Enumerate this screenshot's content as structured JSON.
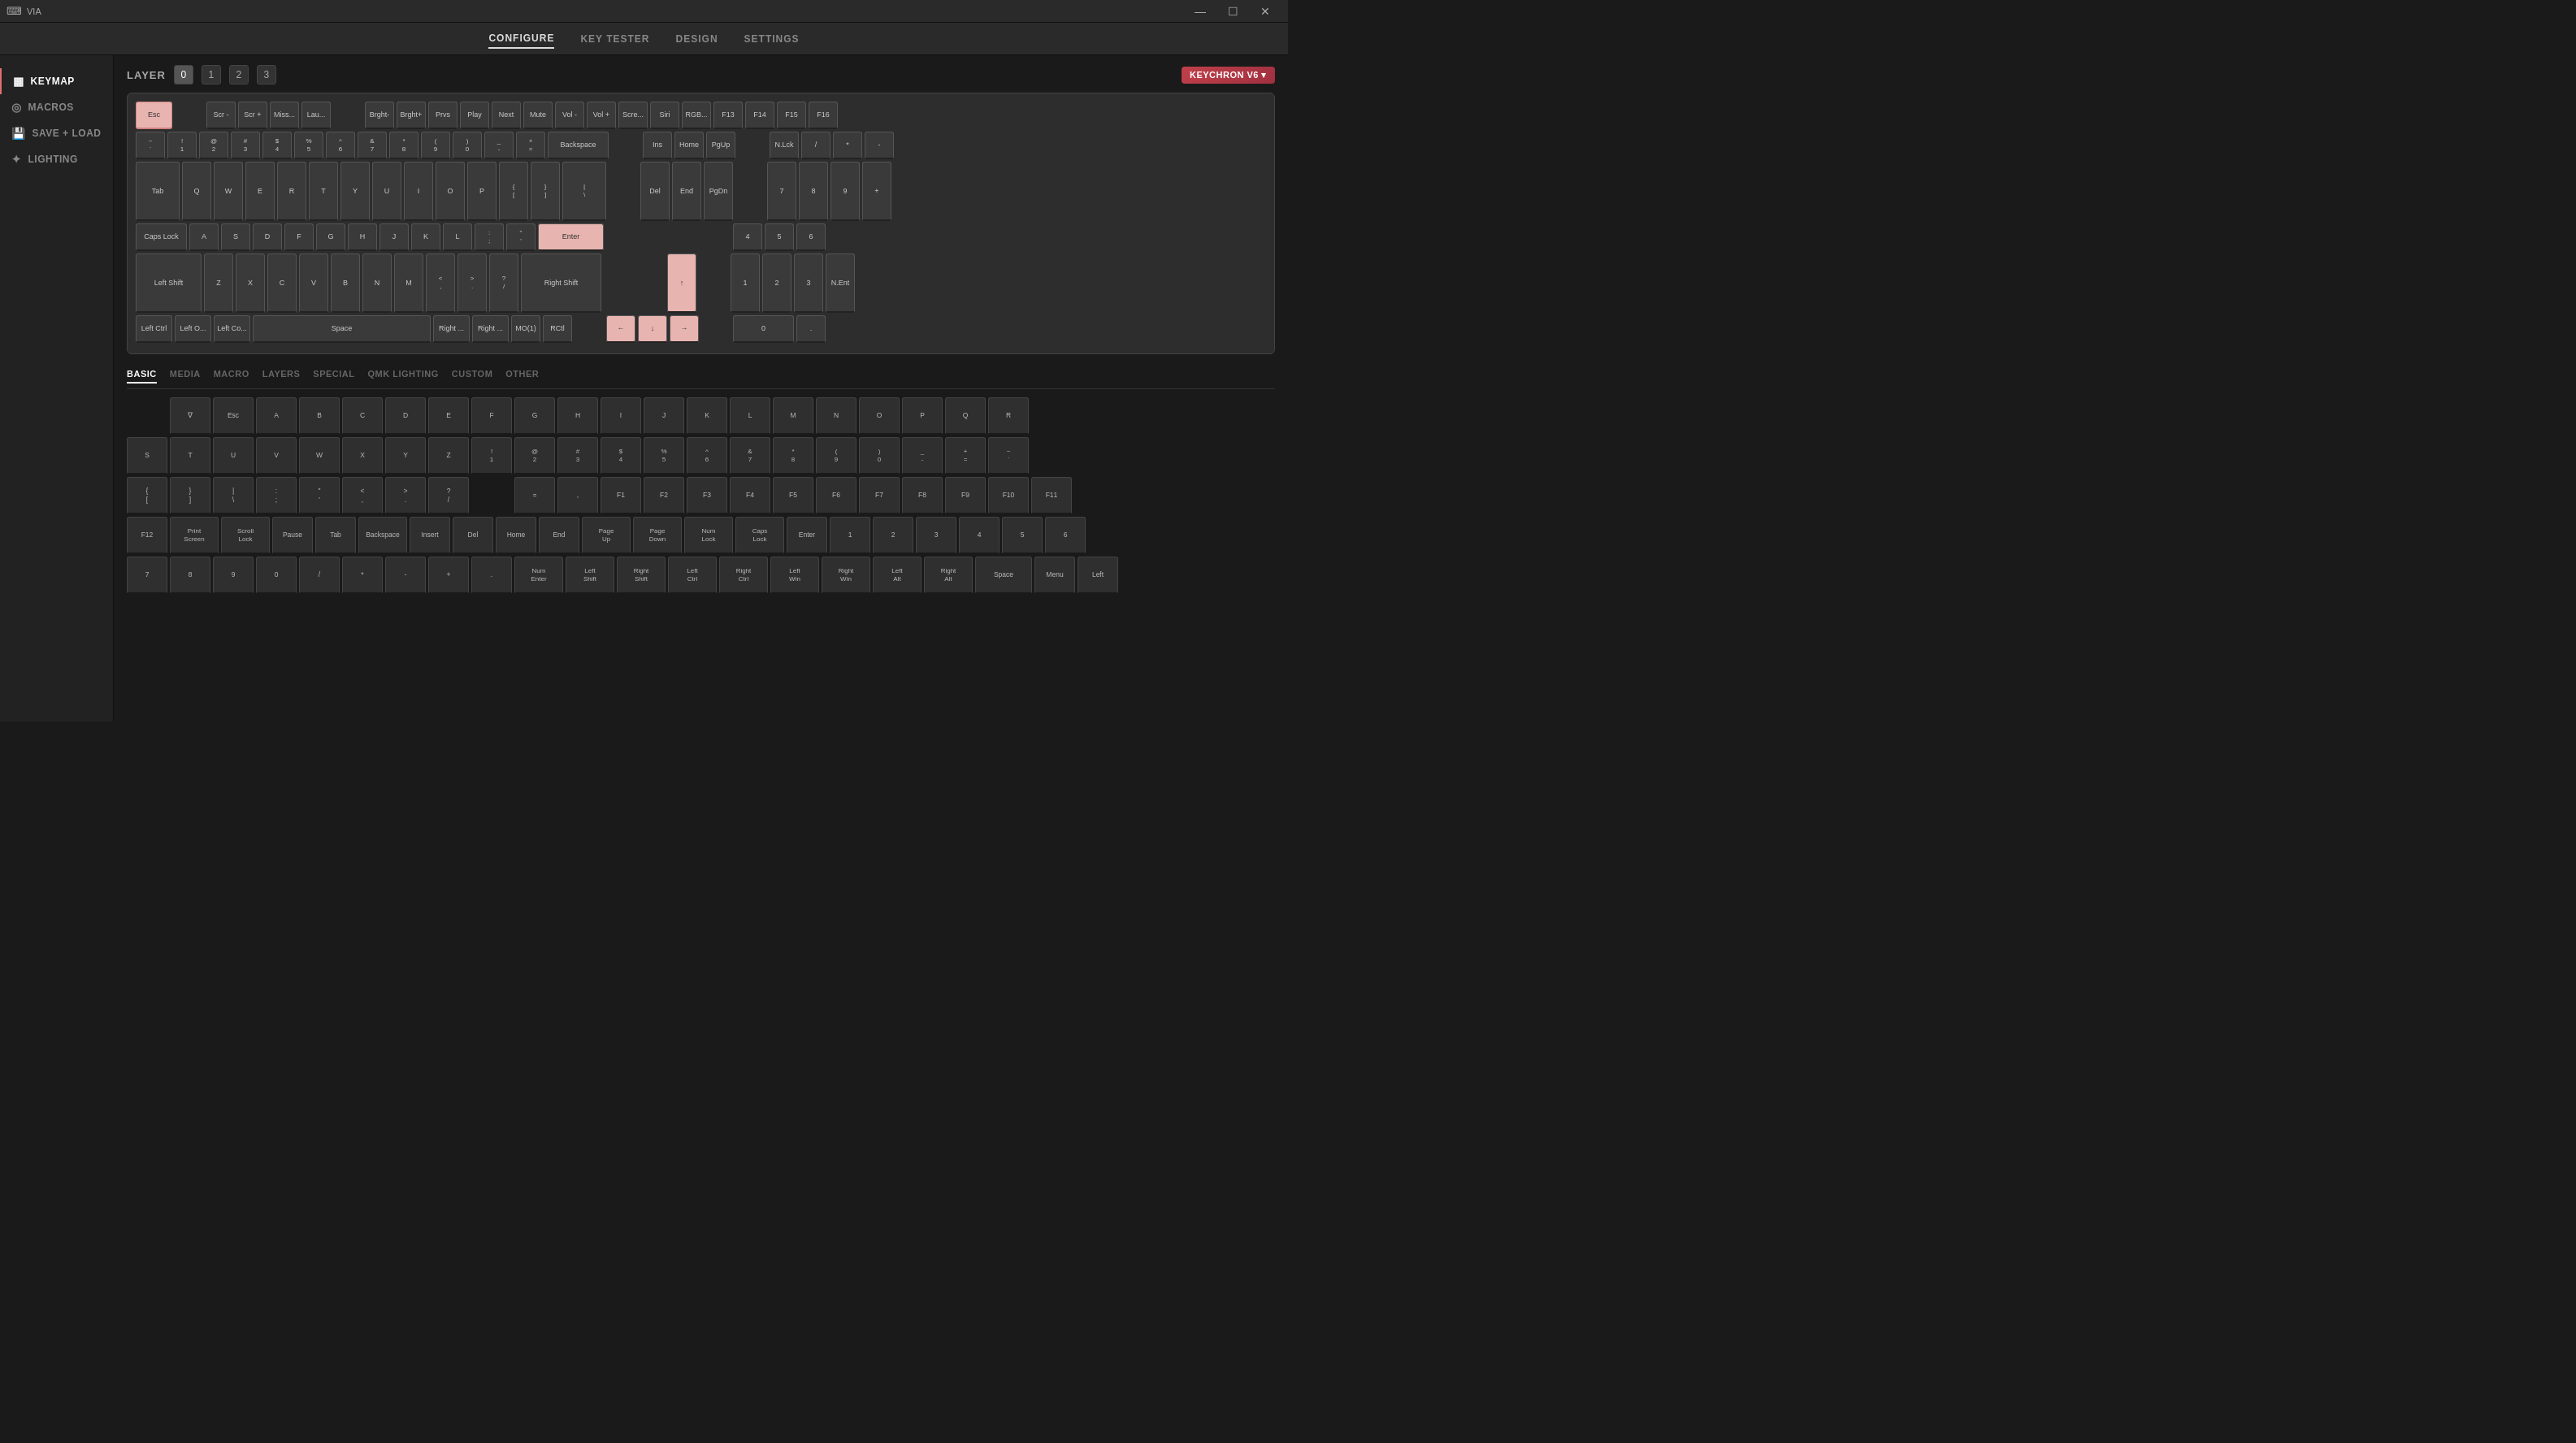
{
  "titlebar": {
    "app_name": "VIA",
    "controls": [
      "minimize",
      "maximize",
      "close"
    ]
  },
  "navbar": {
    "items": [
      {
        "label": "CONFIGURE",
        "active": true
      },
      {
        "label": "KEY TESTER",
        "active": false
      },
      {
        "label": "DESIGN",
        "active": false
      },
      {
        "label": "SETTINGS",
        "active": false
      }
    ]
  },
  "sidebar": {
    "items": [
      {
        "label": "KEYMAP",
        "icon": "grid",
        "active": true
      },
      {
        "label": "MACROS",
        "icon": "circle",
        "active": false
      },
      {
        "label": "SAVE + LOAD",
        "icon": "save",
        "active": false
      },
      {
        "label": "LIGHTING",
        "icon": "light",
        "active": false
      }
    ]
  },
  "layer": {
    "label": "LAYER",
    "values": [
      "0",
      "1",
      "2",
      "3"
    ],
    "active": "0"
  },
  "keychron_badge": "KEYCHRON V6 ▾",
  "keyboard": {
    "rows": [
      [
        "Esc",
        "",
        "Scr -",
        "Scr +",
        "Miss...",
        "Lau...",
        "",
        "Brght-",
        "Brght+",
        "Prvs",
        "Play",
        "Next",
        "Mute",
        "Vol -",
        "Vol +",
        "Scre...",
        "Siri",
        "RGB...",
        "F13",
        "F14",
        "F15",
        "F16"
      ],
      [
        "~`",
        "!1",
        "@2",
        "#3",
        "$4",
        "%5",
        "^6",
        "&7",
        "*8",
        "(9",
        ")0",
        "_-",
        "+=",
        "Backspace",
        "",
        "Ins",
        "Home",
        "PgUp",
        "",
        "N.Lck",
        "/",
        "*",
        "-"
      ],
      [
        "Tab",
        "",
        "Q",
        "W",
        "E",
        "R",
        "T",
        "Y",
        "U",
        "I",
        "O",
        "P",
        "{[",
        "}]",
        "|\\",
        "",
        "Del",
        "End",
        "PgDn",
        "",
        "7",
        "8",
        "9",
        "+"
      ],
      [
        "Caps Lock",
        "",
        "A",
        "S",
        "D",
        "F",
        "G",
        "H",
        "J",
        "K",
        "L",
        ":;",
        "'\"",
        "",
        "Enter",
        "",
        "",
        "",
        "",
        "",
        "4",
        "5",
        "6"
      ],
      [
        "Left Shift",
        "",
        "Z",
        "X",
        "C",
        "V",
        "B",
        "N",
        "M",
        "<,",
        ">.",
        "?/",
        "",
        "Right Shift",
        "",
        "",
        "",
        "↑",
        "",
        "",
        "1",
        "2",
        "3",
        "N.Ent"
      ],
      [
        "Left Ctrl",
        "Left O...",
        "Left Co...",
        "Space",
        "",
        "",
        "",
        "",
        "",
        "",
        "Right ...",
        "Right ...",
        "MO(1)",
        "RCtl",
        "",
        "",
        "←",
        "↓",
        "→",
        "",
        "0",
        "",
        "."
      ]
    ]
  },
  "key_picker": {
    "tabs": [
      "BASIC",
      "MEDIA",
      "MACRO",
      "LAYERS",
      "SPECIAL",
      "QMK LIGHTING",
      "CUSTOM",
      "OTHER"
    ],
    "active_tab": "BASIC",
    "rows": [
      [
        "",
        "∇",
        "Esc",
        "A",
        "B",
        "C",
        "D",
        "E",
        "F",
        "G",
        "H",
        "I",
        "J",
        "K",
        "L",
        "M",
        "N",
        "O",
        "P",
        "Q",
        "R"
      ],
      [
        "S",
        "T",
        "U",
        "V",
        "W",
        "X",
        "Y",
        "Z",
        "!\n1",
        "@\n2",
        "#\n3",
        "$\n4",
        "%\n5",
        "^\n6",
        "&\n7",
        "*\n8",
        "(\n9",
        ")\n0",
        "_\n-",
        "+\n=",
        "~\n`"
      ],
      [
        "{",
        "}",
        "|",
        ":",
        "\"",
        "<",
        ">",
        "?",
        "",
        "=",
        ",",
        "F1",
        "F2",
        "F3",
        "F4",
        "F5",
        "F6",
        "F7",
        "F8",
        "F9",
        "F10",
        "F11"
      ],
      [
        "F12",
        "Print\nScreen",
        "Scroll\nLock",
        "Pause",
        "Tab",
        "Backspace",
        "Insert",
        "Del",
        "Home",
        "End",
        "Page\nUp",
        "Page\nDown",
        "Num\nLock",
        "Caps\nLock",
        "Enter",
        "1",
        "2",
        "3",
        "4",
        "5",
        "6"
      ],
      [
        "7",
        "8",
        "9",
        "0",
        "/",
        "*",
        "-",
        "+",
        ".",
        "Num\nEnter",
        "Left\nShift",
        "Right\nShift",
        "Left\nCtrl",
        "Right\nCtrl",
        "Left\nWin",
        "Right\nWin",
        "Left\nAlt",
        "Right\nAlt",
        "Space",
        "Menu",
        "Left"
      ]
    ]
  }
}
